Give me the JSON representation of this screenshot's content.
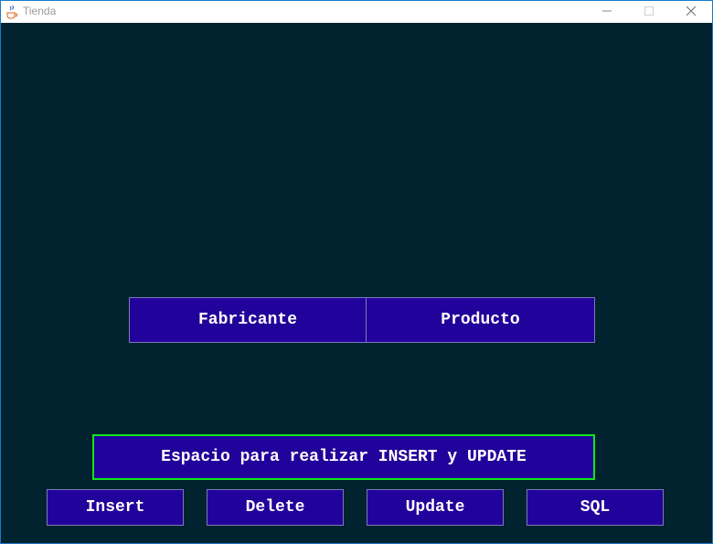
{
  "window": {
    "title": "Tienda",
    "app_icon": "java-coffee-icon",
    "controls": [
      "minimize-icon",
      "maximize-icon",
      "close-icon"
    ]
  },
  "tabs": {
    "fabricante_label": "Fabricante",
    "producto_label": "Producto"
  },
  "info": {
    "text": "Espacio para realizar INSERT y UPDATE"
  },
  "actions": {
    "insert_label": "Insert",
    "delete_label": "Delete",
    "update_label": "Update",
    "sql_label": "SQL"
  },
  "colors": {
    "background": "#012330",
    "button": "#21029a",
    "info_border": "#11e61b",
    "text": "#ffffff"
  }
}
